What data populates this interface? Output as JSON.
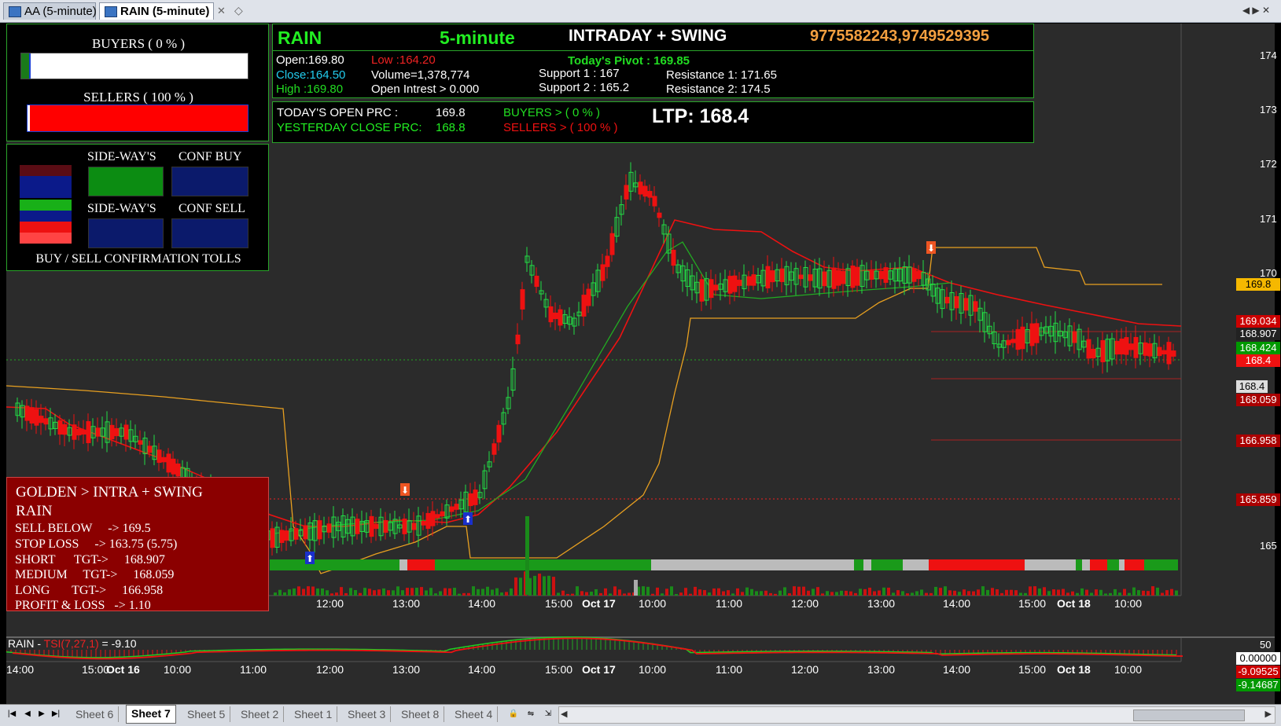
{
  "tabs": [
    {
      "label": "AA (5-minute)",
      "active": false
    },
    {
      "label": "RAIN (5-minute)",
      "active": true
    }
  ],
  "info_panel": {
    "symbol": "RAIN",
    "interval": "5-minute",
    "headline": "INTRADAY + SWING",
    "phones": "9775582243,9749529395",
    "open": "Open:169.80",
    "low": "Low :164.20",
    "pivot": "Today's Pivot :  169.85",
    "close": "Close:164.50",
    "volume": "Volume=1,378,774",
    "support1": "Support 1 : 167",
    "resistance1": "Resistance 1: 171.65",
    "high": "High  :169.80",
    "open_interest": "Open Intrest >    0.000",
    "support2": "Support 2 : 165.2",
    "resistance2": "Resistance 2: 174.5",
    "today_open_label": "TODAY'S OPEN PRC :",
    "today_open_value": "169.8",
    "yest_close_label": "YESTERDAY CLOSE PRC:",
    "yest_close_value": "168.8",
    "buyers": "BUYERS > ( 0 % )",
    "sellers": "SELLERS > ( 100 % )",
    "ltp": "LTP: 168.4"
  },
  "strength_panel": {
    "buyers_label": "BUYERS ( 0 % )",
    "sellers_label": "SELLERS ( 100 % )",
    "buyers_pct": 0,
    "sellers_pct": 100
  },
  "tools_panel": {
    "sideways_top": "SIDE-WAY'S",
    "conf_buy": "CONF BUY",
    "sideways_bottom": "SIDE-WAY'S",
    "conf_sell": "CONF SELL",
    "footer": "BUY / SELL CONFIRMATION TOLLS"
  },
  "golden_box": {
    "title": "GOLDEN > INTRA + SWING",
    "symbol": "RAIN",
    "rows": [
      "SELL BELOW     -> 169.5",
      "STOP LOSS     -> 163.75 (5.75)",
      "SHORT      TGT->     168.907",
      "MEDIUM     TGT->     168.059",
      "LONG       TGT->     166.958",
      "PROFIT & LOSS   -> 1.10"
    ]
  },
  "price_axis": {
    "ticks": [
      "174",
      "173",
      "172",
      "171",
      "170",
      "165"
    ],
    "labels": [
      {
        "text": "169.8",
        "bg": "#f5b800",
        "fg": "#000"
      },
      {
        "text": "169.034",
        "bg": "#cc0000",
        "fg": "#fff"
      },
      {
        "text": "168.907",
        "bg": "#222222",
        "fg": "#fff"
      },
      {
        "text": "168.424",
        "bg": "#009900",
        "fg": "#fff"
      },
      {
        "text": "168.4",
        "bg": "#ee1111",
        "fg": "#fff"
      },
      {
        "text": "168.4",
        "bg": "#dddddd",
        "fg": "#000"
      },
      {
        "text": "168.059",
        "bg": "#aa0000",
        "fg": "#fff"
      },
      {
        "text": "166.958",
        "bg": "#aa0000",
        "fg": "#fff"
      },
      {
        "text": "165.859",
        "bg": "#aa0000",
        "fg": "#fff"
      }
    ]
  },
  "time_axis": [
    "14:00",
    "15:00",
    "Oct 16",
    "10:00",
    "11:00",
    "12:00",
    "13:00",
    "14:00",
    "15:00",
    "Oct 17",
    "10:00",
    "11:00",
    "12:00",
    "13:00",
    "14:00",
    "15:00",
    "Oct 18",
    "10:00"
  ],
  "tsi_panel": {
    "title_symbol": "RAIN - ",
    "title_indicator": "TSI(7,27,1)",
    "title_value": " = -9.10",
    "axis_top": "50",
    "labels": [
      {
        "text": "0.00000",
        "bg": "#ffffff",
        "fg": "#000"
      },
      {
        "text": "-9.09525",
        "bg": "#cc0000",
        "fg": "#fff"
      },
      {
        "text": "-9.14687",
        "bg": "#009900",
        "fg": "#fff"
      }
    ]
  },
  "sheets": [
    "Sheet 6",
    "Sheet 7",
    "Sheet 5",
    "Sheet 2",
    "Sheet 1",
    "Sheet 3",
    "Sheet 8",
    "Sheet 4"
  ],
  "active_sheet": "Sheet 7",
  "colors": {
    "bull": "#22dd44",
    "bear": "#ee1111",
    "panel_border": "#2aa52a",
    "golden_bg": "#8b0000"
  }
}
